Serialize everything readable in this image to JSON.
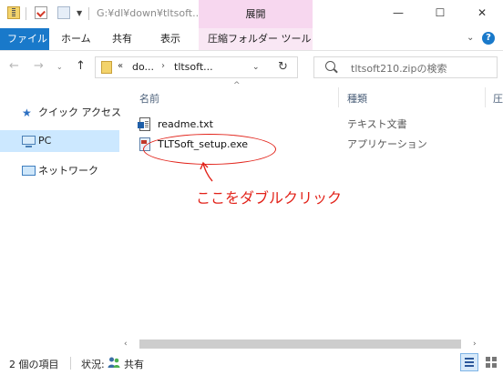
{
  "titlebar": {
    "path": "G:¥dl¥down¥tltsoft...",
    "context_tab_title": "展開",
    "minimize": "—",
    "maximize": "☐",
    "close": "✕"
  },
  "ribbon": {
    "tabs": [
      "ファイル",
      "ホーム",
      "共有",
      "表示",
      "圧縮フォルダー ツール"
    ],
    "expand": "⌄",
    "help": "?"
  },
  "address": {
    "chevrons": "«",
    "segments": [
      "do...",
      "tltsoft..."
    ],
    "separator": "›",
    "dropdown": "⌄",
    "refresh": "↻"
  },
  "search": {
    "placeholder": "tltsoft210.zipの検索"
  },
  "nav": {
    "back": "←",
    "forward": "→",
    "recent": "⌄",
    "up": "↑",
    "items": [
      "クイック アクセス",
      "PC",
      "ネットワーク"
    ],
    "star": "★"
  },
  "columns": {
    "sort_arrow": "^",
    "name": "名前",
    "type": "種類",
    "extra": "圧"
  },
  "files": [
    {
      "name": "readme.txt",
      "type": "テキスト文書"
    },
    {
      "name": "TLTSoft_setup.exe",
      "type": "アプリケーション"
    }
  ],
  "annotation": {
    "text": "ここをダブルクリック",
    "color": "#e2231a"
  },
  "scrollbar": {
    "left": "‹",
    "right": "›"
  },
  "status": {
    "count": "2 個の項目",
    "state_label": "状況:",
    "state_value": "共有"
  },
  "colors": {
    "accent": "#1979ca",
    "context_tab": "#f7d7ef",
    "selection": "#cce8ff"
  },
  "icons": [
    "folder-zip-icon",
    "properties-icon",
    "new-folder-icon",
    "search-icon",
    "star-icon",
    "pc-icon",
    "network-icon",
    "text-file-icon",
    "exe-icon",
    "share-icon"
  ]
}
